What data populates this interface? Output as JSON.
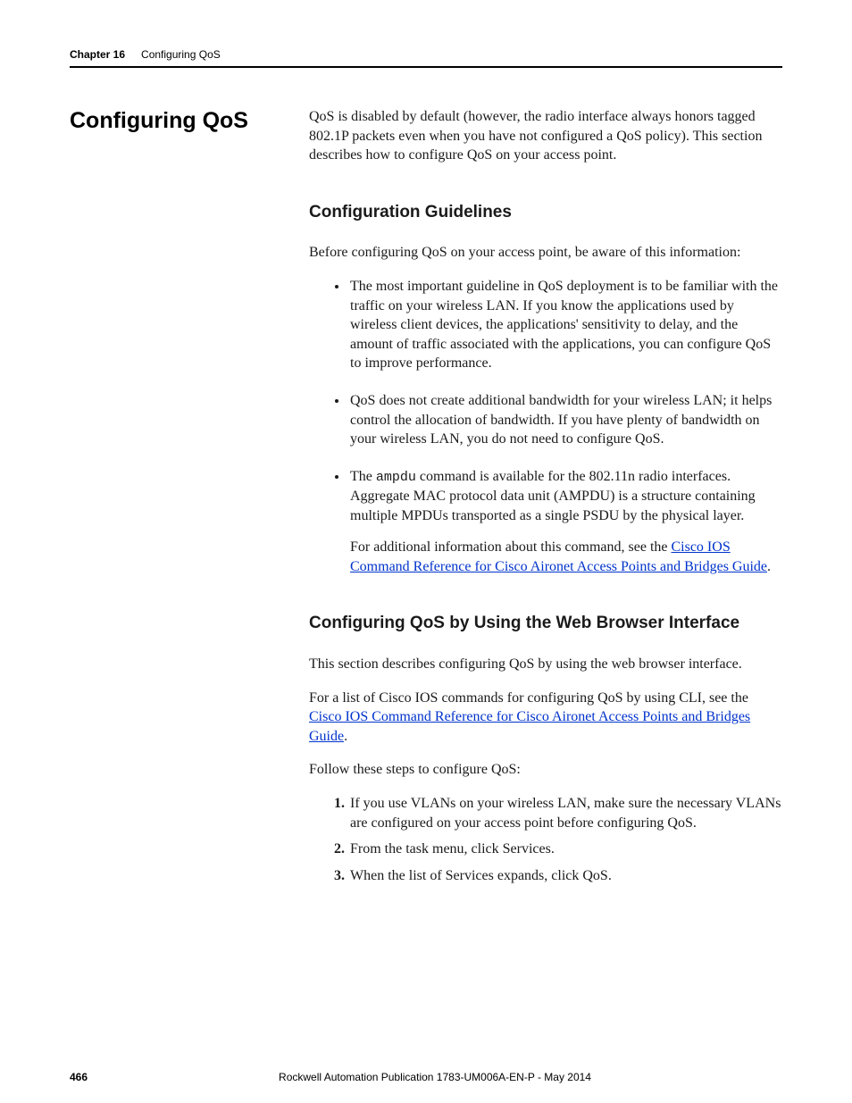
{
  "header": {
    "chapter": "Chapter 16",
    "title": "Configuring QoS"
  },
  "side_heading": "Configuring QoS",
  "intro": "QoS is disabled by default (however, the radio interface always honors tagged 802.1P packets even when you have not configured a QoS policy). This section describes how to configure QoS on your access point.",
  "section1": {
    "heading": "Configuration Guidelines",
    "lead": "Before configuring QoS on your access point, be aware of this information:",
    "bullets": {
      "b1": "The most important guideline in QoS deployment is to be familiar with the traffic on your wireless LAN. If you know the applications used by wireless client devices, the applications' sensitivity to delay, and the amount of traffic associated with the applications, you can configure QoS to improve performance.",
      "b2": "QoS does not create additional bandwidth for your wireless LAN; it helps control the allocation of bandwidth. If you have plenty of bandwidth on your wireless LAN, you do not need to configure QoS.",
      "b3_pre": "The ",
      "b3_code": "ampdu",
      "b3_post": " command is available for the 802.11n radio interfaces. Aggregate MAC protocol data unit (AMPDU) is a structure containing multiple MPDUs transported as a single PSDU by the physical layer.",
      "b3_extra_pre": "For additional information about this command, see the ",
      "b3_link": "Cisco IOS Command Reference for Cisco Aironet Access Points and Bridges Guide",
      "b3_extra_post": "."
    }
  },
  "section2": {
    "heading": "Configuring QoS by Using the Web Browser Interface",
    "p1": "This section describes configuring QoS by using the web browser interface.",
    "p2_pre": "For a list of Cisco IOS commands for configuring QoS by using CLI, see the ",
    "p2_link": "Cisco IOS Command Reference for Cisco Aironet Access Points and Bridges Guide",
    "p2_post": ".",
    "p3": "Follow these steps to configure QoS:",
    "steps": {
      "s1": "If you use VLANs on your wireless LAN, make sure the necessary VLANs are configured on your access point before configuring QoS.",
      "s2": "From the task menu, click Services.",
      "s3": "When the list of Services expands, click QoS."
    }
  },
  "footer": {
    "page": "466",
    "publication": "Rockwell Automation Publication 1783-UM006A-EN-P - May 2014"
  }
}
